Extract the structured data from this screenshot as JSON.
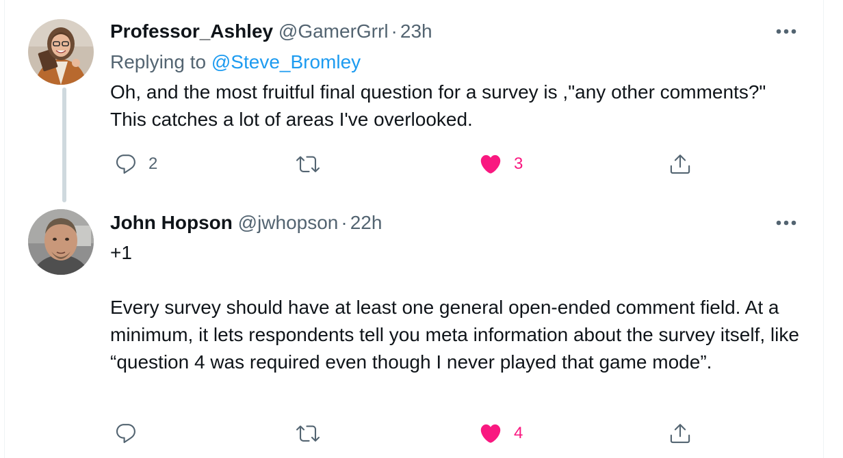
{
  "tweets": [
    {
      "name": "Professor_Ashley",
      "handle": "@GamerGrrl",
      "separator": "·",
      "time": "23h",
      "replying_prefix": "Replying to",
      "replying_to": "@Steve_Bromley",
      "paragraphs": [
        "Oh, and the most fruitful final question for a survey is ,\"any other comments?\" This catches a lot of areas I've overlooked."
      ],
      "replies": "2",
      "retweets": "",
      "likes": "3",
      "liked": true,
      "icons": {
        "reply": "reply-icon",
        "retweet": "retweet-icon",
        "like": "heart-icon",
        "share": "share-icon",
        "more": "more-icon"
      }
    },
    {
      "name": "John Hopson",
      "handle": "@jwhopson",
      "separator": "·",
      "time": "22h",
      "paragraphs": [
        "+1",
        "",
        "Every survey should have at least one general open-ended comment field. At a minimum, it lets respondents tell you meta information about the survey itself, like “question 4 was required even though I never played that game mode”."
      ],
      "replies": "",
      "retweets": "",
      "likes": "4",
      "liked": true,
      "icons": {
        "reply": "reply-icon",
        "retweet": "retweet-icon",
        "like": "heart-icon",
        "share": "share-icon",
        "more": "more-icon"
      }
    }
  ],
  "colors": {
    "text": "#0f1419",
    "secondary": "#536471",
    "link": "#1d9bf0",
    "like": "#f91880",
    "thread_line": "#cfd9de"
  }
}
